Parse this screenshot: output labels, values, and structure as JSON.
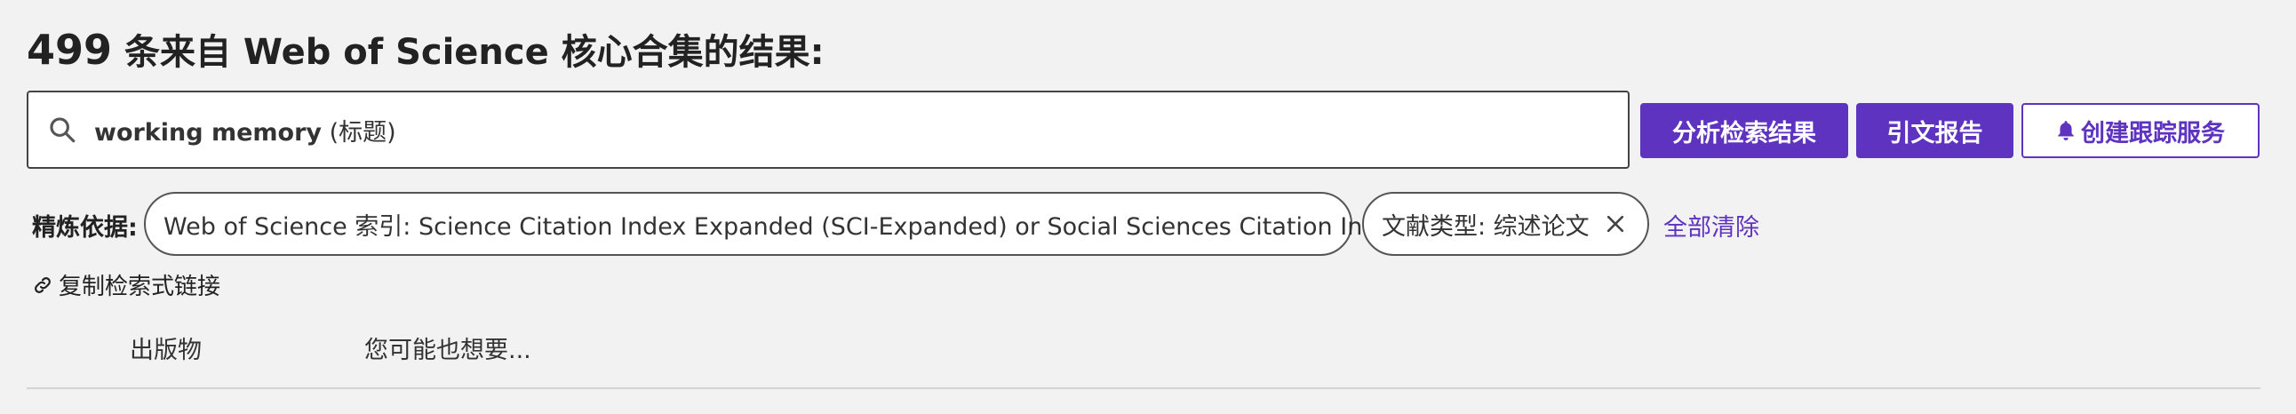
{
  "header": {
    "count": "499",
    "title_rest": " 条来自 Web of Science 核心合集的结果:"
  },
  "search": {
    "query": "working memory",
    "field": " (标题)",
    "icon": "search-icon"
  },
  "actions": {
    "analyze_label": "分析检索结果",
    "citation_label": "引文报告",
    "alert_label": "创建跟踪服务",
    "alert_icon": "bell-icon"
  },
  "refine": {
    "label": "精炼依据:",
    "chips": [
      {
        "label": "Web of Science 索引: Science Citation Index Expanded (SCI-Expanded) or Social Sciences Citation Index (SSCI)"
      },
      {
        "label": "文献类型: 综述论文"
      }
    ],
    "clear_all": "全部清除"
  },
  "copy_link": {
    "label": "复制检索式链接",
    "icon": "link-icon"
  },
  "tabs": [
    {
      "label": "出版物"
    },
    {
      "label": "您可能也想要..."
    }
  ],
  "colors": {
    "accent": "#5e33bf",
    "background": "#f2f2f2",
    "text": "#222222"
  }
}
